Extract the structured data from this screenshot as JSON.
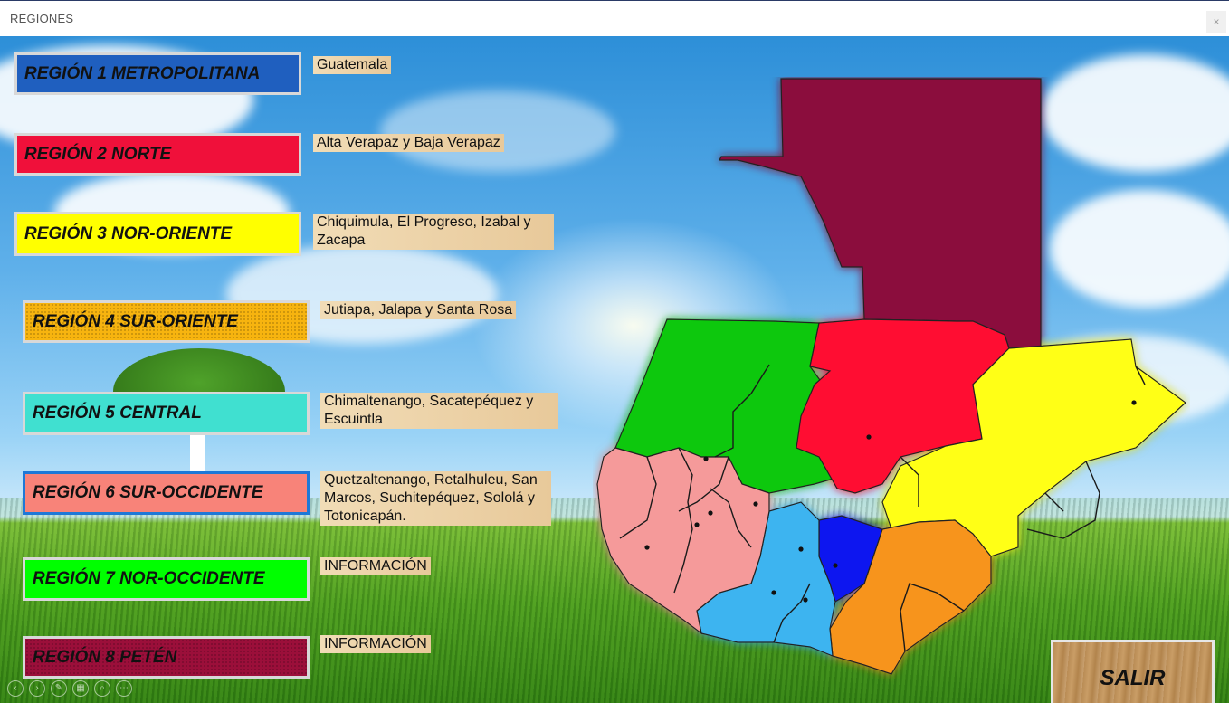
{
  "window": {
    "title": "REGIONES",
    "close_glyph": "×"
  },
  "regions": [
    {
      "label": "REGIÓN 1  METROPOLITANA",
      "color": "#1f5fbf",
      "info": "Guatemala"
    },
    {
      "label": "REGIÓN 2 NORTE",
      "color": "#f0103a",
      "info": "Alta Verapaz y Baja Verapaz"
    },
    {
      "label": "REGIÓN 3 NOR-ORIENTE",
      "color": "#ffff00",
      "info": "Chiquimula, El Progreso, Izabal y Zacapa"
    },
    {
      "label": "REGIÓN 4 SUR-ORIENTE",
      "color": "#f7b40f",
      "info": "Jutiapa, Jalapa y Santa Rosa"
    },
    {
      "label": "REGIÓN 5 CENTRAL",
      "color": "#40e0d0",
      "info": "Chimaltenango, Sacatepéquez y Escuintla"
    },
    {
      "label": "REGIÓN 6 SUR-OCCIDENTE",
      "color": "#f88379",
      "info": "Quetzaltenango, Retalhuleu, San Marcos, Suchitepéquez, Sololá y Totonicapán."
    },
    {
      "label": "REGIÓN 7  NOR-OCCIDENTE",
      "color": "#00ff00",
      "info": "INFORMACIÓN"
    },
    {
      "label": "REGIÓN 8 PETÉN",
      "color": "#9b0f3a",
      "info": "INFORMACIÓN"
    }
  ],
  "exit_button": {
    "label": "SALIR"
  },
  "map_colors": {
    "peten": "#8b0a3c",
    "norte": "#ff0a32",
    "nororiente": "#ffff14",
    "suroriente": "#f7941d",
    "central": "#3cb4f0",
    "metropolitana": "#0a14f0",
    "suroccidente": "#f59a9a",
    "noroccidente": "#0ac80a"
  }
}
